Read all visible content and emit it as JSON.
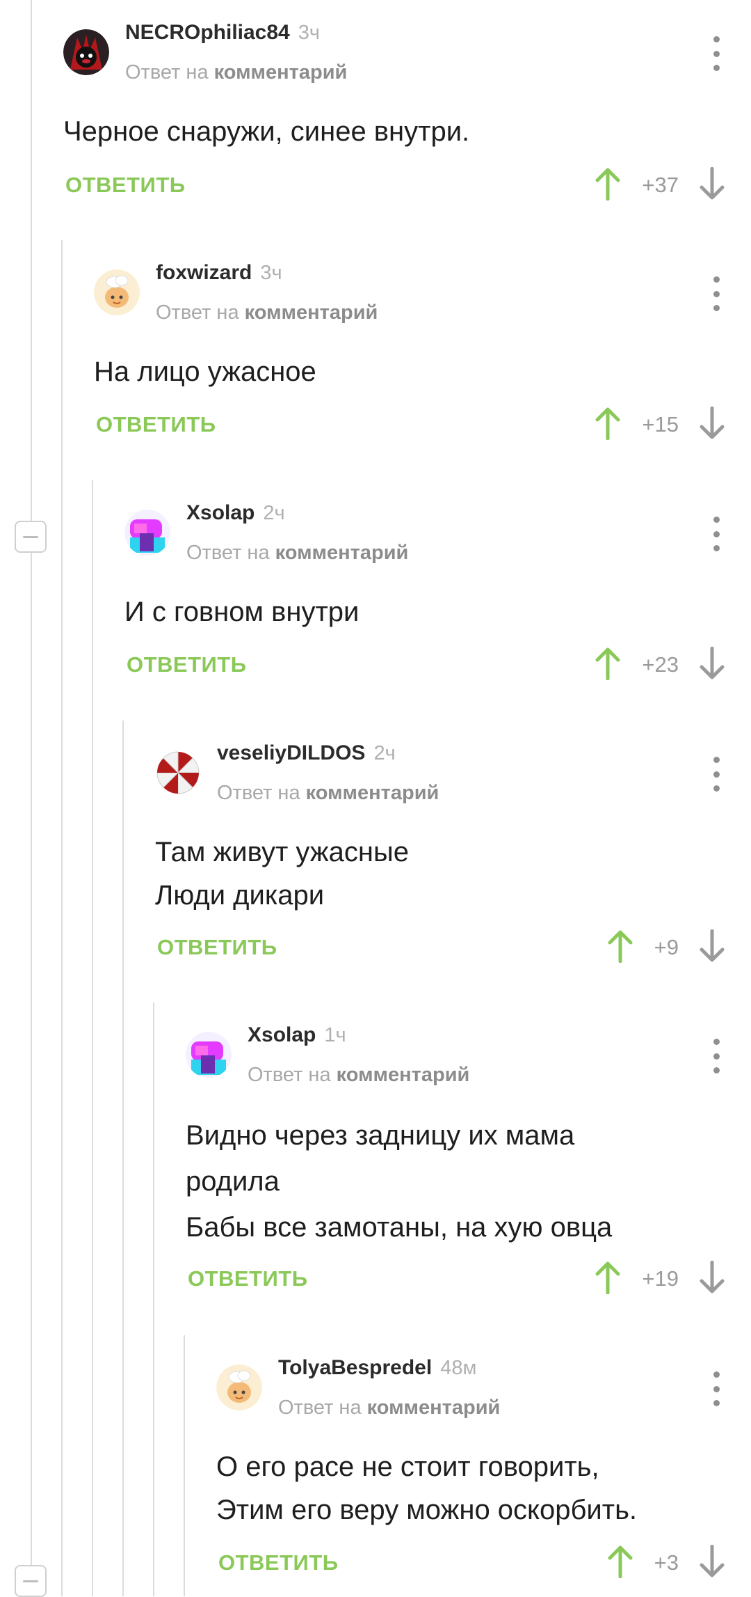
{
  "colors": {
    "accent_green": "#8ac858",
    "gray_text": "#a8a8a8",
    "line": "#dcdcdc"
  },
  "comments": [
    {
      "author": "NECROphiliac84",
      "time": "3ч",
      "reply_prefix": "Ответ на",
      "reply_link": "комментарий",
      "lines": [
        "Черное снаружи, синее внутри."
      ],
      "reply_label": "ОТВЕТИТЬ",
      "rating": "+37",
      "avatar": "dark-bear-avatar"
    },
    {
      "author": "foxwizard",
      "time": "3ч",
      "reply_prefix": "Ответ на",
      "reply_link": "комментарий",
      "lines": [
        "На лицо ужасное"
      ],
      "reply_label": "ОТВЕТИТЬ",
      "rating": "+15",
      "avatar": "chef-avatar"
    },
    {
      "author": "Xsolap",
      "time": "2ч",
      "reply_prefix": "Ответ на",
      "reply_link": "комментарий",
      "lines": [
        "И с говном внутри"
      ],
      "reply_label": "ОТВЕТИТЬ",
      "rating": "+23",
      "avatar": "neon-avatar"
    },
    {
      "author": "veseliyDILDOS",
      "time": "2ч",
      "reply_prefix": "Ответ на",
      "reply_link": "комментарий",
      "lines": [
        "Там живут ужасные",
        "Люди дикари"
      ],
      "reply_label": "ОТВЕТИТЬ",
      "rating": "+9",
      "avatar": "umbrella-avatar"
    },
    {
      "author": "Xsolap",
      "time": "1ч",
      "reply_prefix": "Ответ на",
      "reply_link": "комментарий",
      "lines": [
        "Видно через задницу их мама",
        "родила",
        "Бабы все замотаны, на хую овца"
      ],
      "reply_label": "ОТВЕТИТЬ",
      "rating": "+19",
      "avatar": "neon-avatar"
    },
    {
      "author": "TolyaBespredel",
      "time": "48м",
      "reply_prefix": "Ответ на",
      "reply_link": "комментарий",
      "lines": [
        "О его расе не стоит говорить,",
        "Этим его веру можно оскорбить."
      ],
      "reply_label": "ОТВЕТИТЬ",
      "rating": "+3",
      "avatar": "chef-avatar"
    }
  ]
}
